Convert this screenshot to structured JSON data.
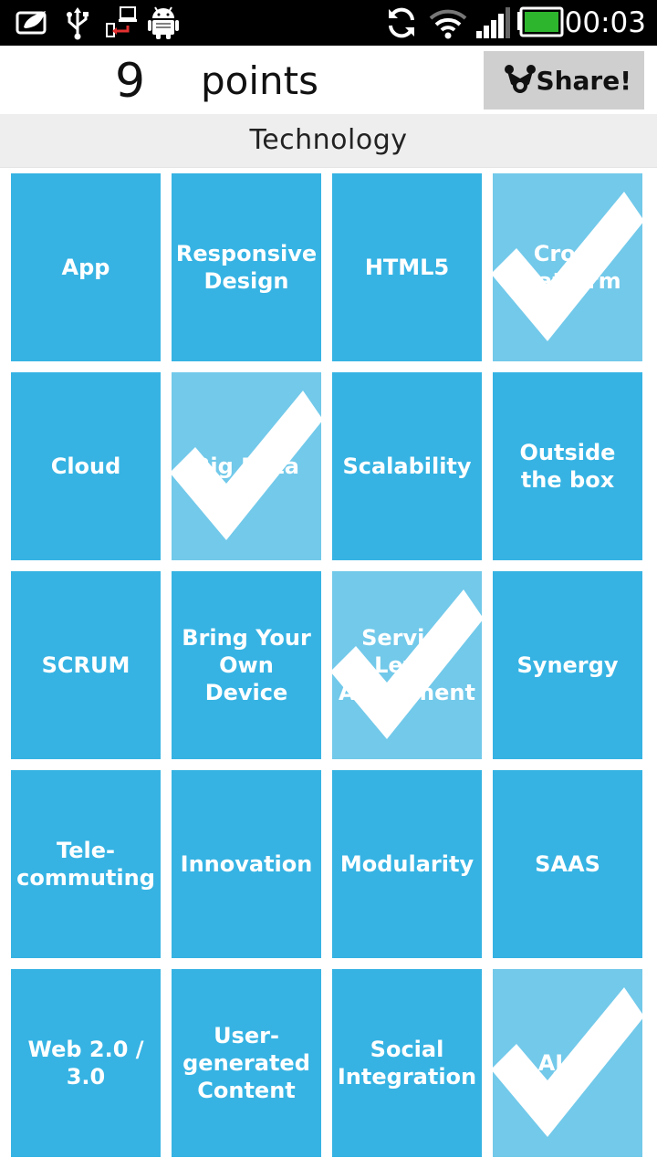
{
  "status_bar": {
    "time": "00:03",
    "icons": [
      "leaf-notification-icon",
      "usb-icon",
      "usb-debug-icon",
      "android-icon",
      "sync-icon",
      "wifi-icon",
      "signal-icon",
      "battery-icon"
    ]
  },
  "header": {
    "score": "9",
    "points_label": "points",
    "share_label": "Share!",
    "share_icon": "share-icon"
  },
  "category": "Technology",
  "colors": {
    "tile": "#36b3e3",
    "tile_checked": "#72c9ea",
    "share_bg": "#cfcfcf"
  },
  "tiles": [
    {
      "label": "App",
      "checked": false
    },
    {
      "label": "Responsive Design",
      "checked": false
    },
    {
      "label": "HTML5",
      "checked": false
    },
    {
      "label": "Cross Platform",
      "checked": true
    },
    {
      "label": "Cloud",
      "checked": false
    },
    {
      "label": "Big Data",
      "checked": true
    },
    {
      "label": "Scalability",
      "checked": false
    },
    {
      "label": "Outside the box",
      "checked": false
    },
    {
      "label": "SCRUM",
      "checked": false
    },
    {
      "label": "Bring Your Own Device",
      "checked": false
    },
    {
      "label": "Service Level Agreement",
      "checked": true
    },
    {
      "label": "Synergy",
      "checked": false
    },
    {
      "label": "Tele-commuting",
      "checked": false
    },
    {
      "label": "Innovation",
      "checked": false
    },
    {
      "label": "Modularity",
      "checked": false
    },
    {
      "label": "SAAS",
      "checked": false
    },
    {
      "label": "Web 2.0 / 3.0",
      "checked": false
    },
    {
      "label": "User-generated Content",
      "checked": false
    },
    {
      "label": "Social Integration",
      "checked": false
    },
    {
      "label": "AJAX",
      "checked": true
    }
  ]
}
